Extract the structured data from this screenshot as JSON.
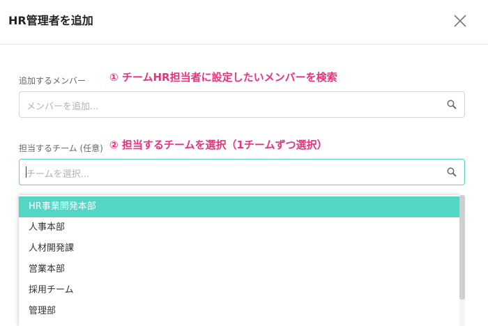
{
  "dialog": {
    "title": "HR管理者を追加"
  },
  "member_field": {
    "label": "追加するメンバー",
    "annotation": "① チームHR担当者に設定したいメンバーを検索",
    "placeholder": "メンバーを追加..."
  },
  "team_field": {
    "label": "担当するチーム (任意)",
    "annotation": "② 担当するチームを選択（1チームずつ選択）",
    "placeholder": "チームを選択..."
  },
  "team_options": [
    {
      "label": "HR事業開発本部",
      "highlighted": true
    },
    {
      "label": "人事本部"
    },
    {
      "label": "人材開発課"
    },
    {
      "label": "営業本部"
    },
    {
      "label": "採用チーム"
    },
    {
      "label": "管理部"
    }
  ],
  "colors": {
    "accent": "#53d6c4",
    "annotation": "#f0307a"
  },
  "icons": {
    "close": "close-icon",
    "search": "search-icon"
  }
}
